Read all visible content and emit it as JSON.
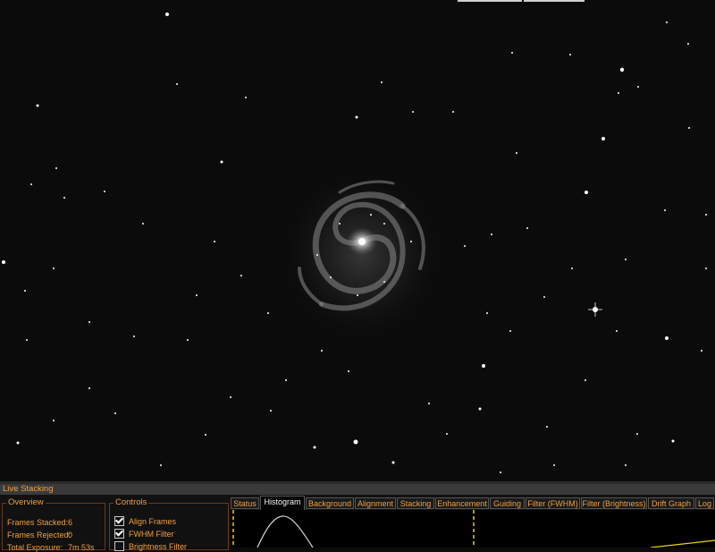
{
  "panel": {
    "title": "Live Stacking",
    "overview": {
      "legend": "Overview",
      "rows": [
        {
          "label": "Frames Stacked:",
          "value": "6"
        },
        {
          "label": "Frames Rejected:",
          "value": "0"
        },
        {
          "label": "Total Exposure:",
          "value": "7m 53s"
        }
      ]
    },
    "controls": {
      "legend": "Controls",
      "items": [
        {
          "label": "Align Frames",
          "checked": true
        },
        {
          "label": "FWHM Filter",
          "checked": true
        },
        {
          "label": "Brightness Filter",
          "checked": false
        }
      ]
    },
    "tabs": [
      {
        "label": "Status",
        "active": false
      },
      {
        "label": "Histogram",
        "active": true
      },
      {
        "label": "Background",
        "active": false
      },
      {
        "label": "Alignment",
        "active": false
      },
      {
        "label": "Stacking",
        "active": false
      },
      {
        "label": "Enhancement",
        "active": false
      },
      {
        "label": "Guiding",
        "active": false
      },
      {
        "label": "Filter (FWHM)",
        "active": false
      },
      {
        "label": "Filter (Brightness)",
        "active": false
      },
      {
        "label": "Drift Graph",
        "active": false
      },
      {
        "label": "Log",
        "active": false
      }
    ]
  },
  "colors": {
    "accent": "#f0a040",
    "sky": "#0b0b0b",
    "histogram_marker": "#e8d21a"
  },
  "icons": {
    "check": "check-icon"
  }
}
